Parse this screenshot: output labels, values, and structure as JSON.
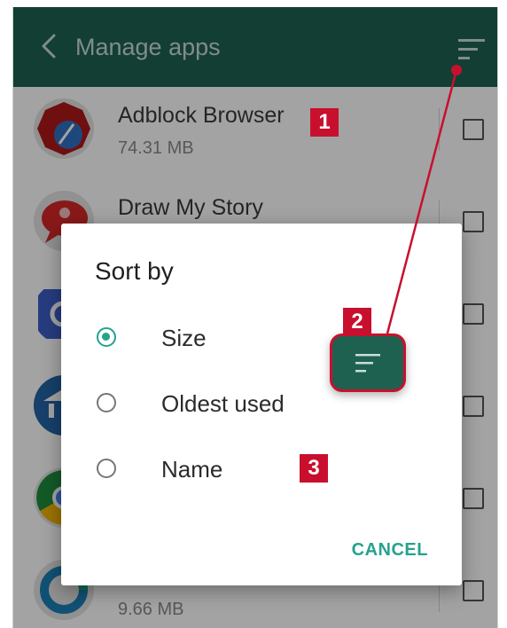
{
  "appbar": {
    "title": "Manage apps",
    "back_icon": "chevron-left-icon",
    "sort_icon": "sort-icon"
  },
  "apps": [
    {
      "name": "Adblock Browser",
      "size": "74.31 MB",
      "icon": "adblock-browser-icon"
    },
    {
      "name": "Draw My Story",
      "size": "",
      "icon": "draw-my-story-icon"
    },
    {
      "name": "",
      "size": "",
      "icon": "google-app-icon"
    },
    {
      "name": "",
      "size": "",
      "icon": "bank-app-icon"
    },
    {
      "name": "",
      "size": "",
      "icon": "chrome-app-icon"
    },
    {
      "name": "",
      "size": "9.66 MB",
      "icon": "sync-app-icon"
    }
  ],
  "dialog": {
    "title": "Sort by",
    "options": [
      {
        "label": "Size",
        "selected": true
      },
      {
        "label": "Oldest used",
        "selected": false
      },
      {
        "label": "Name",
        "selected": false
      }
    ],
    "cancel_label": "CANCEL"
  },
  "callouts": [
    "1",
    "2",
    "3"
  ],
  "colors": {
    "appbar": "#1e6150",
    "accent": "#26a28e",
    "callout": "#c8102e"
  }
}
